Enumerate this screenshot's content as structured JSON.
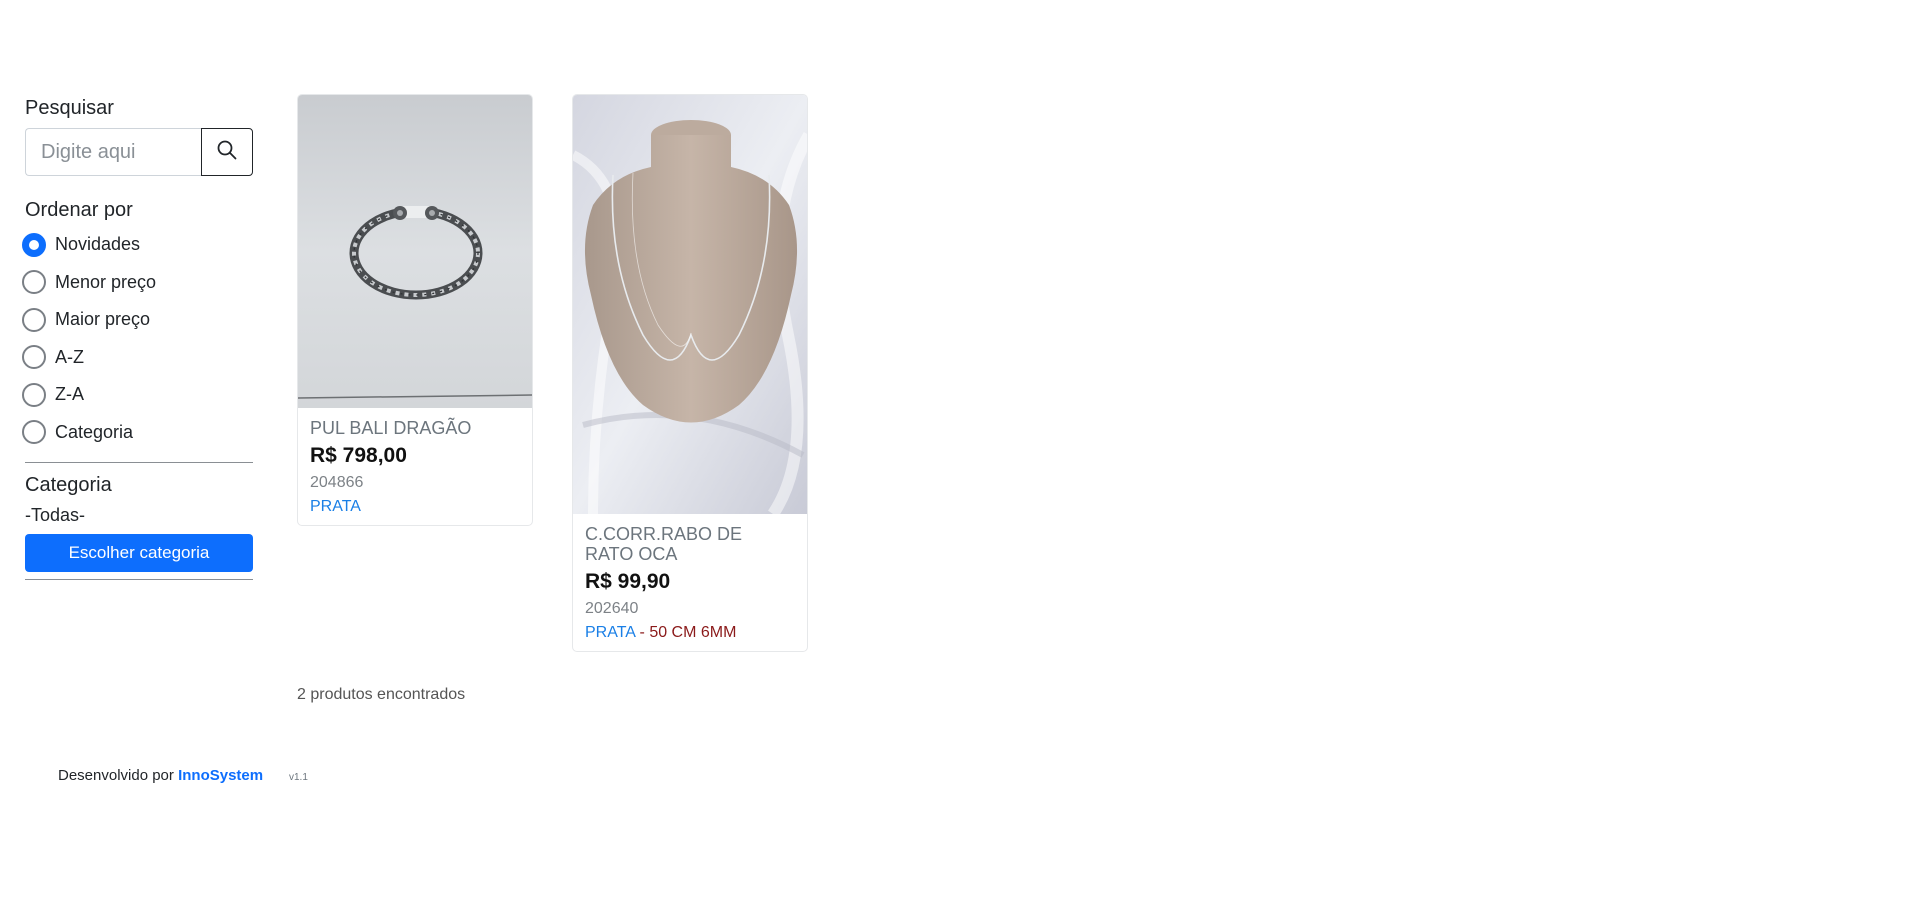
{
  "sidebar": {
    "search_title": "Pesquisar",
    "search_placeholder": "Digite aqui",
    "order_title": "Ordenar por",
    "order_options": [
      {
        "label": "Novidades",
        "checked": true
      },
      {
        "label": "Menor preço",
        "checked": false
      },
      {
        "label": "Maior preço",
        "checked": false
      },
      {
        "label": "A-Z",
        "checked": false
      },
      {
        "label": "Z-A",
        "checked": false
      },
      {
        "label": "Categoria",
        "checked": false
      }
    ],
    "category_title": "Categoria",
    "category_value": "-Todas-",
    "category_button": "Escolher categoria"
  },
  "products": [
    {
      "name": "PUL BALI DRAGÃO",
      "price": "R$ 798,00",
      "code": "204866",
      "tag": "PRATA",
      "tag_separator": "",
      "tag_extra": "",
      "image": "bracelet"
    },
    {
      "name": "C.CORR.RABO DE RATO OCA",
      "price": "R$ 99,90",
      "code": "202640",
      "tag": "PRATA",
      "tag_separator": " - ",
      "tag_extra": "50 CM 6MM",
      "image": "necklace"
    }
  ],
  "results_count": "2 produtos encontrados",
  "footer": {
    "prefix": "Desenvolvido por ",
    "brand": "InnoSystem",
    "version": "v1.1"
  },
  "colors": {
    "accent": "#0d6efd",
    "tag_blue": "#1a7fe6",
    "tag_red": "#8b1a1a"
  }
}
